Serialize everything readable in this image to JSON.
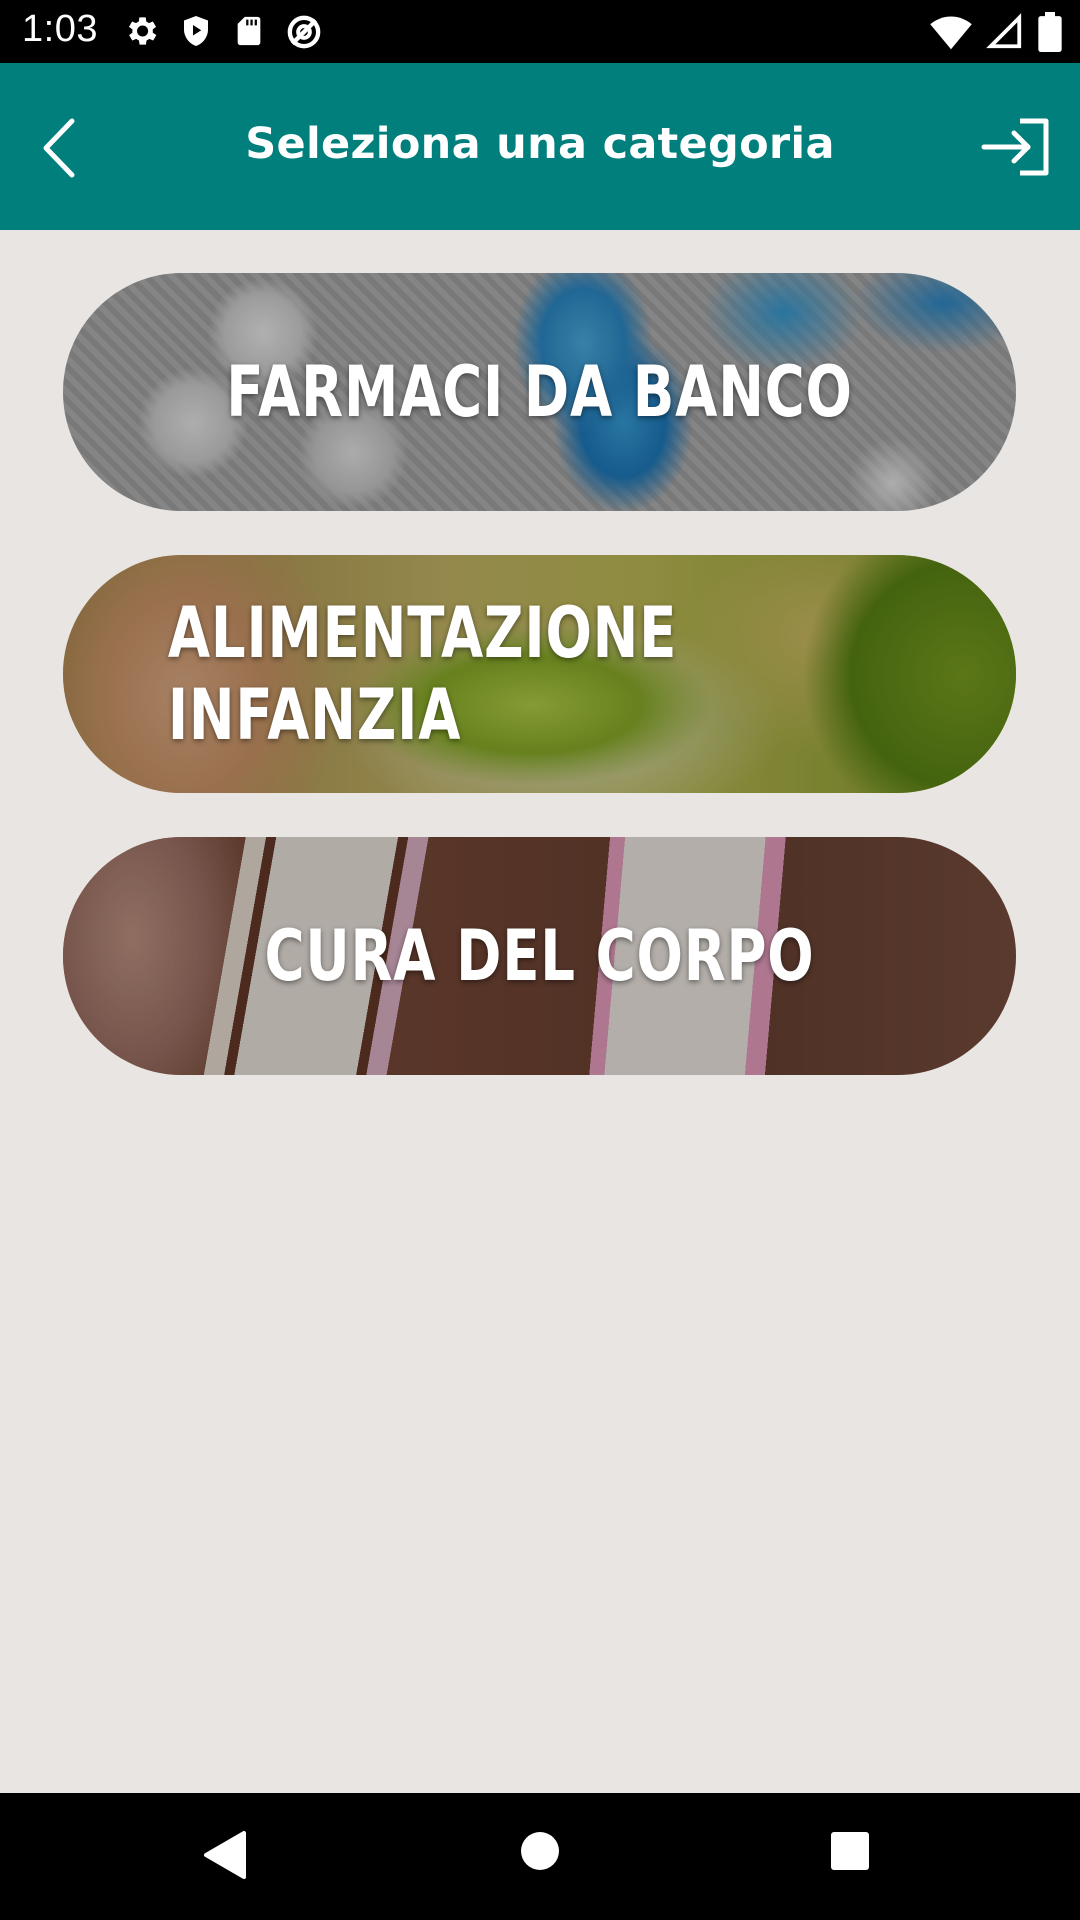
{
  "status_bar": {
    "time": "1:03",
    "icons_left": [
      "gear-icon",
      "play-shield-icon",
      "sd-card-icon",
      "no-sync-icon"
    ],
    "icons_right": [
      "wifi-icon",
      "signal-icon",
      "battery-icon"
    ]
  },
  "app_bar": {
    "title": "Seleziona una categoria",
    "back_icon": "chevron-left-icon",
    "login_icon": "login-arrow-icon",
    "color": "#007f7c"
  },
  "categories": [
    {
      "label": "FARMACI DA BANCO"
    },
    {
      "label": "ALIMENTAZIONE INFANZIA"
    },
    {
      "label": "CURA DEL CORPO"
    }
  ],
  "nav_bar": {
    "buttons": [
      "back-triangle-icon",
      "home-circle-icon",
      "recents-square-icon"
    ]
  },
  "colors": {
    "background": "#e8e5e3",
    "accent": "#007f7c"
  }
}
